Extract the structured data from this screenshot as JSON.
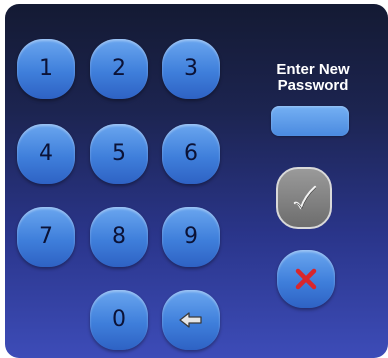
{
  "keypad": {
    "keys": [
      "1",
      "2",
      "3",
      "4",
      "5",
      "6",
      "7",
      "8",
      "9",
      "0"
    ],
    "backspace_icon": "back-arrow-icon"
  },
  "password_field": {
    "label": "Enter New Password",
    "value": ""
  },
  "actions": {
    "confirm_icon": "checkmark-icon",
    "cancel_icon": "x-icon"
  },
  "colors": {
    "key_blue": "#4a8ae0",
    "cancel_red": "#d8262c",
    "confirm_gray": "#7a7a7a"
  }
}
